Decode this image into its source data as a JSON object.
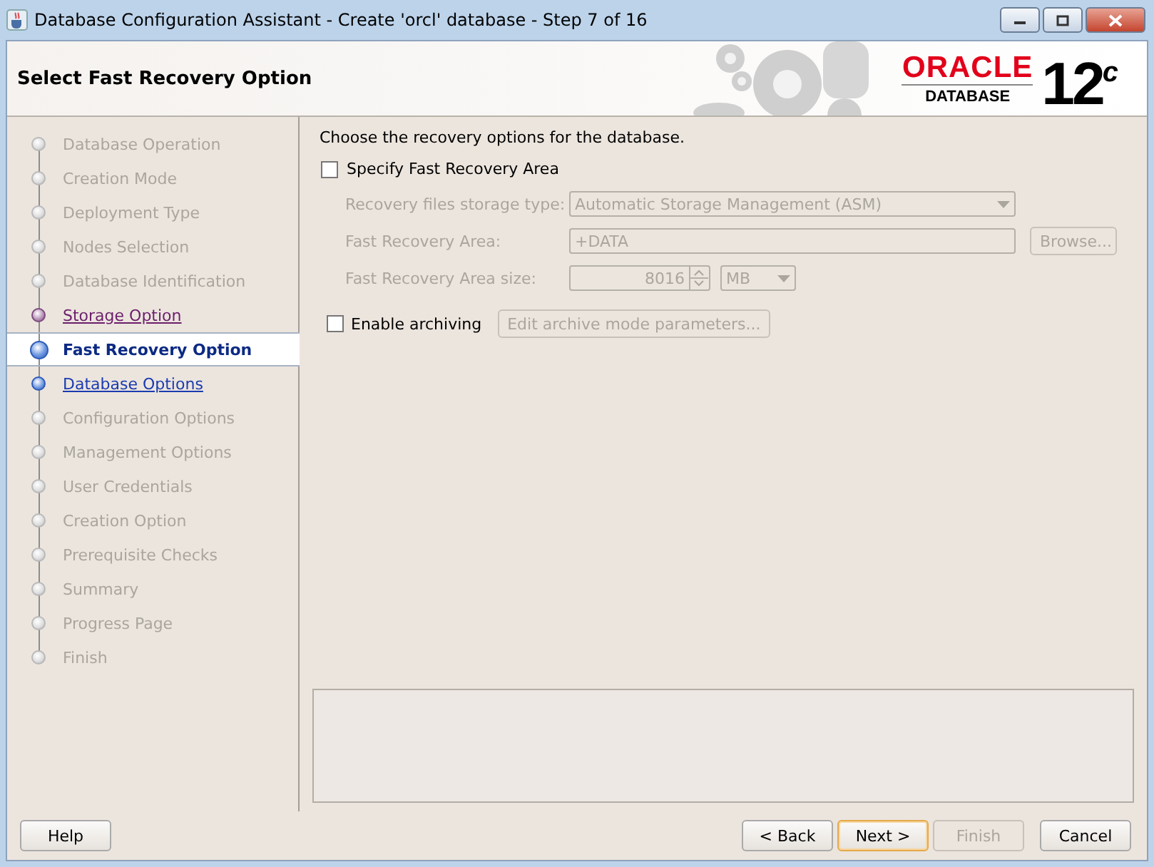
{
  "window": {
    "title": "Database Configuration Assistant - Create 'orcl' database - Step 7 of 16"
  },
  "header": {
    "title": "Select Fast Recovery Option",
    "logo": {
      "brand": "ORACLE",
      "product": "DATABASE",
      "version": "12",
      "suffix": "c"
    }
  },
  "steps": [
    {
      "label": "Database Operation",
      "selected": false,
      "visited": false,
      "enabled": false
    },
    {
      "label": "Creation Mode",
      "selected": false,
      "visited": false,
      "enabled": false
    },
    {
      "label": "Deployment Type",
      "selected": false,
      "visited": false,
      "enabled": false
    },
    {
      "label": "Nodes Selection",
      "selected": false,
      "visited": false,
      "enabled": false
    },
    {
      "label": "Database Identification",
      "selected": false,
      "visited": false,
      "enabled": false
    },
    {
      "label": "Storage Option",
      "selected": false,
      "visited": true,
      "enabled": true
    },
    {
      "label": "Fast Recovery Option",
      "selected": true,
      "visited": false,
      "enabled": true
    },
    {
      "label": "Database Options",
      "selected": false,
      "visited": false,
      "enabled": true
    },
    {
      "label": "Configuration Options",
      "selected": false,
      "visited": false,
      "enabled": false
    },
    {
      "label": "Management Options",
      "selected": false,
      "visited": false,
      "enabled": false
    },
    {
      "label": "User Credentials",
      "selected": false,
      "visited": false,
      "enabled": false
    },
    {
      "label": "Creation Option",
      "selected": false,
      "visited": false,
      "enabled": false
    },
    {
      "label": "Prerequisite Checks",
      "selected": false,
      "visited": false,
      "enabled": false
    },
    {
      "label": "Summary",
      "selected": false,
      "visited": false,
      "enabled": false
    },
    {
      "label": "Progress Page",
      "selected": false,
      "visited": false,
      "enabled": false
    },
    {
      "label": "Finish",
      "selected": false,
      "visited": false,
      "enabled": false
    }
  ],
  "content": {
    "instruction": "Choose the recovery options for the database.",
    "fast_recovery": {
      "label": "Specify Fast Recovery Area",
      "checked": false
    },
    "storage_type": {
      "label": "Recovery files storage type:",
      "value": "Automatic Storage Management (ASM)",
      "disabled": true
    },
    "area": {
      "label": "Fast Recovery Area:",
      "value": "+DATA",
      "button": "Browse...",
      "disabled": true
    },
    "size": {
      "label": "Fast Recovery Area size:",
      "value": "8016",
      "unit": "MB",
      "disabled": true
    },
    "archiving": {
      "label": "Enable archiving",
      "checked": false,
      "button": "Edit archive mode parameters...",
      "disabled": true
    }
  },
  "buttons": [
    {
      "label": "Help",
      "disabled": false,
      "default": false
    },
    {
      "label": "< Back",
      "disabled": false,
      "default": false
    },
    {
      "label": "Next >",
      "disabled": false,
      "default": true
    },
    {
      "label": "Finish",
      "disabled": true,
      "default": false
    },
    {
      "label": "Cancel",
      "disabled": false,
      "default": false
    }
  ]
}
